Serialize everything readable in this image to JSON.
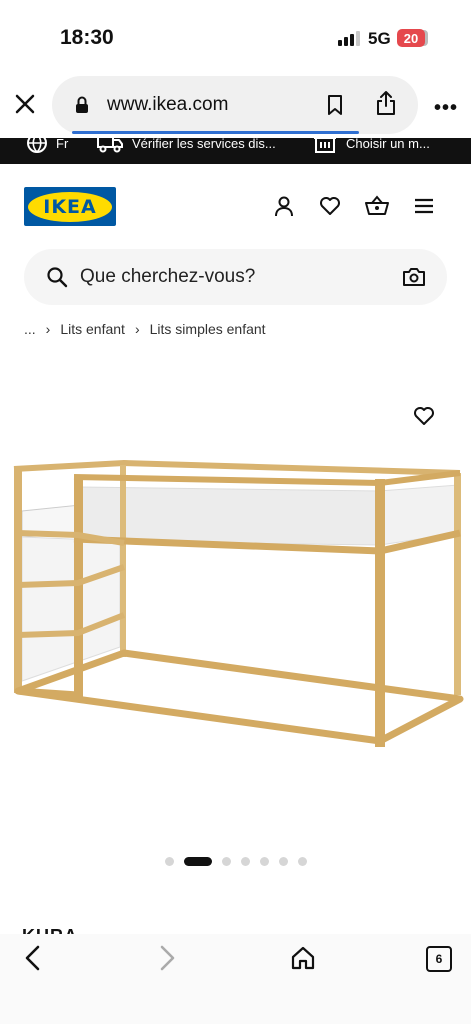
{
  "status": {
    "time": "18:30",
    "network": "5G",
    "battery": "20"
  },
  "browser": {
    "url": "www.ikea.com",
    "more": "•••"
  },
  "promo": {
    "items": [
      {
        "text": "Fr"
      },
      {
        "text": "Vérifier les services dis..."
      },
      {
        "text": "Choisir un m..."
      }
    ]
  },
  "header": {
    "logo": "IKEA"
  },
  "search": {
    "placeholder": "Que cherchez-vous?"
  },
  "breadcrumb": {
    "ellipsis": "...",
    "items": [
      "Lits enfant",
      "Lits simples enfant"
    ]
  },
  "product": {
    "name_partial": "KURA"
  },
  "gallery": {
    "count": 7,
    "active": 2
  },
  "tabs": {
    "count": "6"
  },
  "colors": {
    "ikea_blue": "#0058a3",
    "ikea_yellow": "#ffdb00",
    "battery": "#e5484d",
    "progress": "#2f6fd1"
  }
}
